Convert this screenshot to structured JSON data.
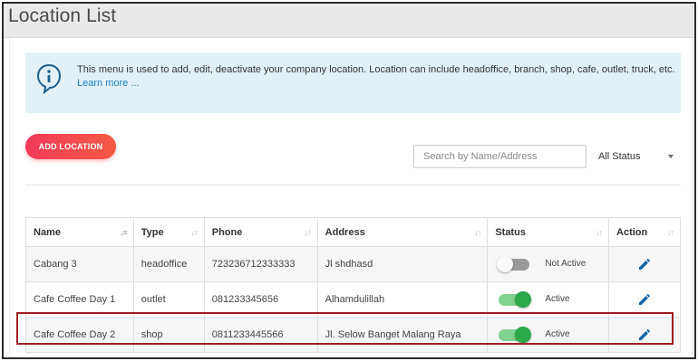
{
  "page": {
    "title": "Location List"
  },
  "info": {
    "text": "This menu is used to add, edit, deactivate your company location. Location can include headoffice, branch, shop, cafe, outlet, truck, etc.",
    "link": "Learn more ..."
  },
  "toolbar": {
    "add_label": "ADD LOCATION",
    "search_placeholder": "Search by Name/Address",
    "status_filter": "All Status"
  },
  "table": {
    "headers": [
      "Name",
      "Type",
      "Phone",
      "Address",
      "Status",
      "Action"
    ],
    "rows": [
      {
        "name": "Cabang 3",
        "type": "headoffice",
        "phone": "723236712333333",
        "address": "Jl shdhasd",
        "status": "Not Active",
        "active": false
      },
      {
        "name": "Cafe Coffee Day 1",
        "type": "outlet",
        "phone": "081233345656",
        "address": "Alhamdulillah",
        "status": "Active",
        "active": true
      },
      {
        "name": "Cafe Coffee Day 2",
        "type": "shop",
        "phone": "0811233445566",
        "address": "Jl. Selow Banget Malang Raya",
        "status": "Active",
        "active": true
      }
    ]
  },
  "icons": {
    "info": "info-icon",
    "edit": "pencil-icon",
    "sort": "sort-icon",
    "dropdown": "chevron-down-icon"
  },
  "colors": {
    "accent": "#1e7fbf",
    "add_button": "#f23a5a",
    "toggle_on": "#2aa84a",
    "highlight_border": "#a01d22",
    "info_bg": "#e2f1f8"
  }
}
